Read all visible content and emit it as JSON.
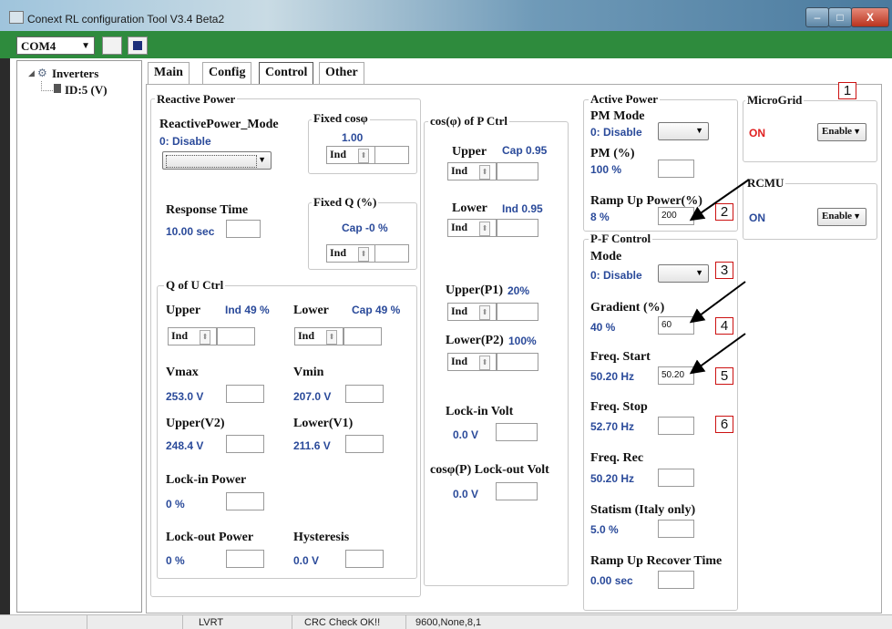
{
  "window": {
    "title": "Conext RL configuration Tool V3.4 Beta2",
    "min": "–",
    "max": "□",
    "close": "X"
  },
  "toolbar": {
    "port": "COM4"
  },
  "tree": {
    "root": "Inverters",
    "child": "ID:5 (V)"
  },
  "tabs": [
    "Main",
    "Config",
    "Control",
    "Other"
  ],
  "reactive": {
    "group": "Reactive Power",
    "mode_label": "ReactivePower_Mode",
    "mode_value": "0: Disable",
    "fixed_cos_label": "Fixed cosφ",
    "fixed_cos_value": "1.00",
    "fixed_cos_sel": "Ind",
    "response_label": "Response Time",
    "response_value": "10.00 sec",
    "fixedq_label": "Fixed Q (%)",
    "fixedq_value": "Cap -0 %",
    "fixedq_sel": "Ind"
  },
  "qofu": {
    "group": "Q of U Ctrl",
    "upper_label": "Upper",
    "upper_value": "Ind 49 %",
    "upper_sel": "Ind",
    "lower_label": "Lower",
    "lower_value": "Cap 49 %",
    "lower_sel": "Ind",
    "vmax_label": "Vmax",
    "vmax_value": "253.0 V",
    "vmin_label": "Vmin",
    "vmin_value": "207.0 V",
    "upperv2_label": "Upper(V2)",
    "upperv2_value": "248.4 V",
    "lowerv1_label": "Lower(V1)",
    "lowerv1_value": "211.6 V",
    "lockin_label": "Lock-in Power",
    "lockin_value": "0 %",
    "lockout_label": "Lock-out Power",
    "lockout_value": "0 %",
    "hyst_label": "Hysteresis",
    "hyst_value": "0.0 V"
  },
  "cosp": {
    "group": "cos(φ) of P Ctrl",
    "upper_label": "Upper",
    "upper_value": "Cap 0.95",
    "upper_sel": "Ind",
    "lower_label": "Lower",
    "lower_value": "Ind 0.95",
    "lower_sel": "Ind",
    "upperp1_label": "Upper(P1)",
    "upperp1_value": "20%",
    "upperp1_sel": "Ind",
    "lowerp2_label": "Lower(P2)",
    "lowerp2_value": "100%",
    "lowerp2_sel": "Ind",
    "lockin_label": "Lock-in Volt",
    "lockin_value": "0.0 V",
    "lockout_label": "cosφ(P) Lock-out Volt",
    "lockout_value": "0.0 V"
  },
  "active": {
    "group": "Active Power",
    "pm_mode_label": "PM Mode",
    "pm_mode_value": "0: Disable",
    "pm_label": "PM (%)",
    "pm_value": "100 %",
    "ramp_label": "Ramp Up Power(%)",
    "ramp_value": "8 %",
    "ramp_input": "200"
  },
  "pf": {
    "group": "P-F Control",
    "mode_label": "Mode",
    "mode_value": "0: Disable",
    "gradient_label": "Gradient (%)",
    "gradient_value": "40 %",
    "gradient_input": "60",
    "fstart_label": "Freq. Start",
    "fstart_value": "50.20 Hz",
    "fstart_input": "50.20",
    "fstop_label": "Freq. Stop",
    "fstop_value": "52.70 Hz",
    "frec_label": "Freq. Rec",
    "frec_value": "50.20 Hz",
    "statism_label": "Statism (Italy only)",
    "statism_value": "5.0 %",
    "recover_label": "Ramp Up Recover Time",
    "recover_value": "0.00 sec"
  },
  "microgrid": {
    "group": "MicroGrid",
    "status": "ON",
    "select": "Enable"
  },
  "rcmu": {
    "group": "RCMU",
    "status": "ON",
    "select": "Enable"
  },
  "callouts": [
    "1",
    "2",
    "3",
    "4",
    "5",
    "6"
  ],
  "status": {
    "lvrt": "LVRT",
    "crc": "CRC Check OK!!",
    "serial": "9600,None,8,1"
  },
  "colors": {
    "toolbar": "#2e8b3d",
    "value_blue": "#2a4a9a",
    "on_red": "#e02020",
    "callout_red": "#cc1111"
  }
}
